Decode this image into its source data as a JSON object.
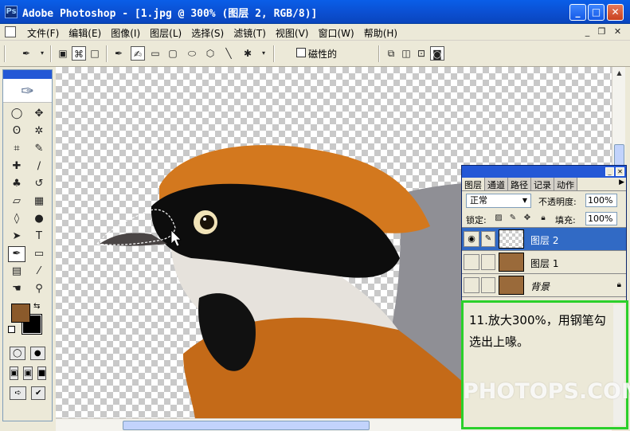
{
  "window": {
    "title": "Adobe Photoshop - [1.jpg @ 300% (图层 2, RGB/8)]",
    "app_icon": "Ps",
    "minimize_glyph": "_",
    "maximize_glyph": "□",
    "close_glyph": "✕",
    "mdi_minimize_glyph": "_",
    "mdi_restore_glyph": "❐",
    "mdi_close_glyph": "✕"
  },
  "menu": [
    {
      "label": "文件(F)"
    },
    {
      "label": "编辑(E)"
    },
    {
      "label": "图像(I)"
    },
    {
      "label": "图层(L)"
    },
    {
      "label": "选择(S)"
    },
    {
      "label": "滤镜(T)"
    },
    {
      "label": "视图(V)"
    },
    {
      "label": "窗口(W)"
    },
    {
      "label": "帮助(H)"
    }
  ],
  "options_bar": {
    "magnetic_label": "磁性的",
    "magnetic_checked": false,
    "active_tool": "freeform-pen"
  },
  "toolbox": {
    "tools": [
      {
        "name": "marquee-icon",
        "glyph": "◯"
      },
      {
        "name": "move-icon",
        "glyph": "✥"
      },
      {
        "name": "lasso-icon",
        "glyph": "ʘ"
      },
      {
        "name": "magic-wand-icon",
        "glyph": "✲"
      },
      {
        "name": "crop-icon",
        "glyph": "⌗"
      },
      {
        "name": "slice-icon",
        "glyph": "✎"
      },
      {
        "name": "healing-brush-icon",
        "glyph": "✚"
      },
      {
        "name": "brush-icon",
        "glyph": "∕"
      },
      {
        "name": "stamp-icon",
        "glyph": "♣"
      },
      {
        "name": "history-brush-icon",
        "glyph": "↺"
      },
      {
        "name": "eraser-icon",
        "glyph": "▱"
      },
      {
        "name": "gradient-icon",
        "glyph": "▦"
      },
      {
        "name": "blur-icon",
        "glyph": "◊"
      },
      {
        "name": "dodge-icon",
        "glyph": "●"
      },
      {
        "name": "path-select-icon",
        "glyph": "➤"
      },
      {
        "name": "type-icon",
        "glyph": "T"
      },
      {
        "name": "pen-icon",
        "glyph": "✒"
      },
      {
        "name": "shape-icon",
        "glyph": "▭"
      },
      {
        "name": "notes-icon",
        "glyph": "▤"
      },
      {
        "name": "eyedropper-icon",
        "glyph": "⁄"
      },
      {
        "name": "hand-icon",
        "glyph": "☚"
      },
      {
        "name": "zoom-icon",
        "glyph": "⚲"
      }
    ],
    "selected_tool": "pen-icon",
    "fg_color": "#8b5a2b",
    "bg_color": "#000000"
  },
  "layers_panel": {
    "tabs": [
      "图层",
      "通道",
      "路径",
      "记录",
      "动作"
    ],
    "active_tab": "图层",
    "blend_mode": "正常",
    "opacity_label": "不透明度:",
    "opacity": "100%",
    "lock_label": "锁定:",
    "fill_label": "填充:",
    "fill": "100%",
    "layers": [
      {
        "name": "图层 2",
        "visible": true,
        "selected": true,
        "thumb": "checker"
      },
      {
        "name": "图层 1",
        "visible": false,
        "selected": false,
        "thumb": "photo"
      },
      {
        "name": "背景",
        "visible": false,
        "selected": false,
        "thumb": "photo",
        "locked": true
      }
    ]
  },
  "note": {
    "text": "11.放大300%，用钢笔勾选出上喙。"
  },
  "watermark": "PHOTOPS.COM",
  "colors": {
    "titlebar": "#0b4fd1",
    "selected_layer": "#316ac5",
    "note_border": "#2bd02b"
  }
}
